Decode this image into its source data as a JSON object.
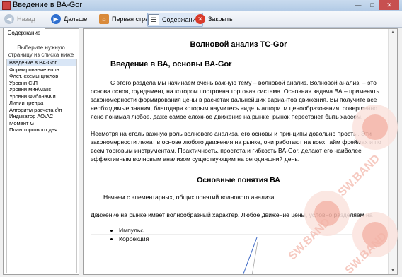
{
  "window": {
    "title": "Введение в ВА-Gor"
  },
  "toolbar": {
    "back_label": "Назад",
    "forward_label": "Дальше",
    "home_label": "Первая страница",
    "contents_label": "Содержание",
    "close_label": "Закрыть"
  },
  "sidebar": {
    "tab_label": "Содержание",
    "hint": "Выберите нужную страницу из списка ниже",
    "items": [
      "Введение в ВА-Gor",
      "Формирование волн",
      "Флет, схемы циклов",
      "Уровни С\\П",
      "Уровни мин\\макс",
      "Уровни Фибоначчи",
      "Линии тренда",
      "Алгоритм расчета с\\п",
      "Индикатор АО\\АС",
      "Момент G",
      "План торгового дня"
    ]
  },
  "content": {
    "title": "Волновой анализ TC-Gor",
    "section1": "Введение в ВА, основы ВА-Gor",
    "para1": "С этого раздела мы начинаем очень важную тему – волновой анализ. Волновой анализ, – это основа основ, фундамент, на котором построена торговая система. Основная задача ВА – применять закономерности формирования цены в расчетах дальнейших вариантов движения. Вы получите все необходимые знания, благодаря которым научитесь видеть алгоритм ценообразования, совершенно ясно понимая любое, даже самое сложное движение на рынке, рынок перестанет быть хаосом.",
    "para2": "Несмотря на столь важную роль волнового анализа, его основы и принципы довольно просты. Эти закономерности лежат в основе любого движения на рынке, они работают на всех тайм фреймах и по всем торговым инструментам. Практичность, простота и гибкость ВА-Gor, делают его наиболее эффективным волновым анализом существующим на сегодняшний день.",
    "section2": "Основные понятия ВА",
    "para3": "Начнем с элементарных, общих понятий волнового анализа",
    "para4": "Движение на рынке имеет волнообразный характер. Любое движение цены, условно разделяем на",
    "bullets": [
      "Импульс",
      "Коррекция"
    ]
  },
  "watermark": {
    "text": "SW.BAND"
  }
}
